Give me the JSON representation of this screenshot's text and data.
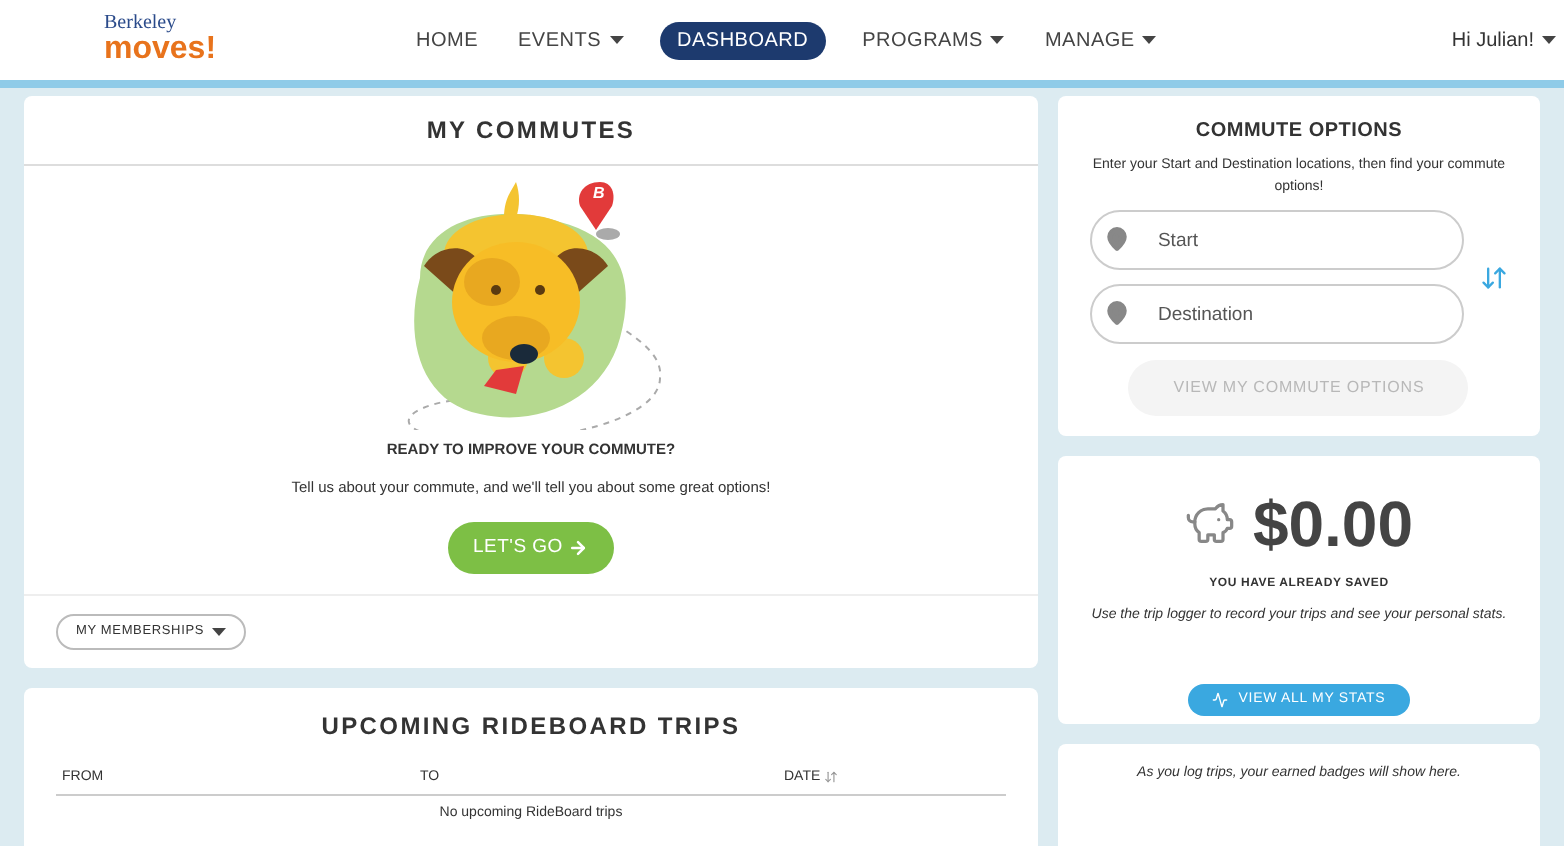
{
  "logo": {
    "top": "Berkeley",
    "bottom": "moves!"
  },
  "nav": [
    {
      "label": "HOME",
      "selected": false,
      "has_menu": false
    },
    {
      "label": "EVENTS",
      "selected": false,
      "has_menu": true
    },
    {
      "label": "DASHBOARD",
      "selected": true,
      "has_menu": false
    },
    {
      "label": "PROGRAMS",
      "selected": false,
      "has_menu": true
    },
    {
      "label": "MANAGE",
      "selected": false,
      "has_menu": true
    }
  ],
  "user_menu": "Hi Julian!",
  "my_commutes": {
    "title": "MY COMMUTES",
    "pin_label": "B",
    "heading": "READY TO IMPROVE YOUR COMMUTE?",
    "text": "Tell us about your commute, and we'll tell you about some great options!",
    "button": "LET'S GO",
    "memberships": "MY MEMBERSHIPS"
  },
  "rideboard": {
    "title": "UPCOMING RIDEBOARD TRIPS",
    "columns": [
      "FROM",
      "TO",
      "DATE"
    ],
    "empty": "No upcoming RideBoard trips"
  },
  "commute_options": {
    "title": "COMMUTE OPTIONS",
    "text": "Enter your Start and Destination locations, then find your commute options!",
    "start": {
      "placeholder": "Start"
    },
    "destination": {
      "placeholder": "Destination"
    },
    "button": {
      "label": "VIEW MY COMMUTE OPTIONS",
      "disabled": true
    }
  },
  "savings": {
    "amount": "$0.00",
    "label": "YOU HAVE ALREADY SAVED",
    "text": "Use the trip logger to record your trips and see your personal stats.",
    "button": "VIEW ALL MY STATS"
  },
  "badges": {
    "text": "As you log trips, your earned badges will show here."
  }
}
